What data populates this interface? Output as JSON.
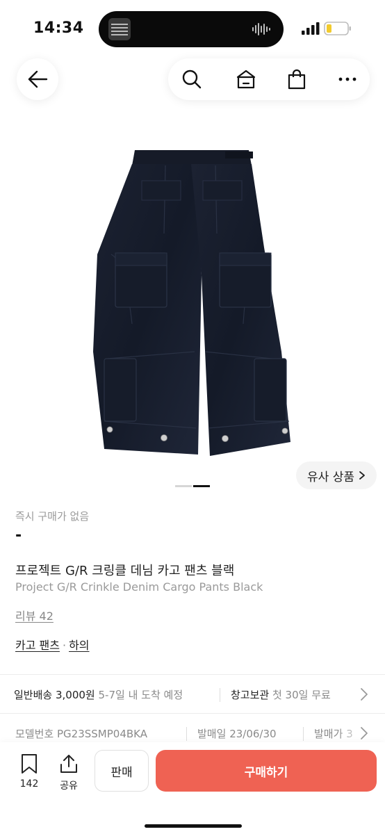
{
  "status_bar": {
    "time": "14:34"
  },
  "header": {
    "back_icon": "arrow-left-icon",
    "icons": [
      "search-icon",
      "home-icon",
      "shopping-bag-icon",
      "more-icon"
    ]
  },
  "gallery": {
    "similar_label": "유사 상품",
    "page_index": 2,
    "page_count": 2
  },
  "product": {
    "instant_label": "즉시 구매가 없음",
    "price": "-",
    "title_ko": "프로젝트 G/R 크링클 데님 카고 팬츠 블랙",
    "title_en": "Project G/R Crinkle Denim Cargo Pants Black",
    "review": "리뷰 42",
    "category_main": "카고 팬츠",
    "category_sep": "·",
    "category_sub": "하의"
  },
  "shipping": {
    "normal_label": "일반배송",
    "normal_price": "3,000원",
    "normal_eta": "5-7일 내 도착 예정",
    "storage_label": "창고보관",
    "storage_note": "첫 30일 무료"
  },
  "meta": {
    "model_label": "모델번호",
    "model_value": "PG23SSMP04BKA",
    "release_label": "발매일",
    "release_value": "23/06/30",
    "retail_label": "발매가",
    "retail_value": "3"
  },
  "bottom_bar": {
    "bookmark_count": "142",
    "share_label": "공유",
    "sell_label": "판매",
    "buy_label": "구매하기"
  },
  "colors": {
    "accent": "#ef6253",
    "muted": "#8a8a8a"
  }
}
